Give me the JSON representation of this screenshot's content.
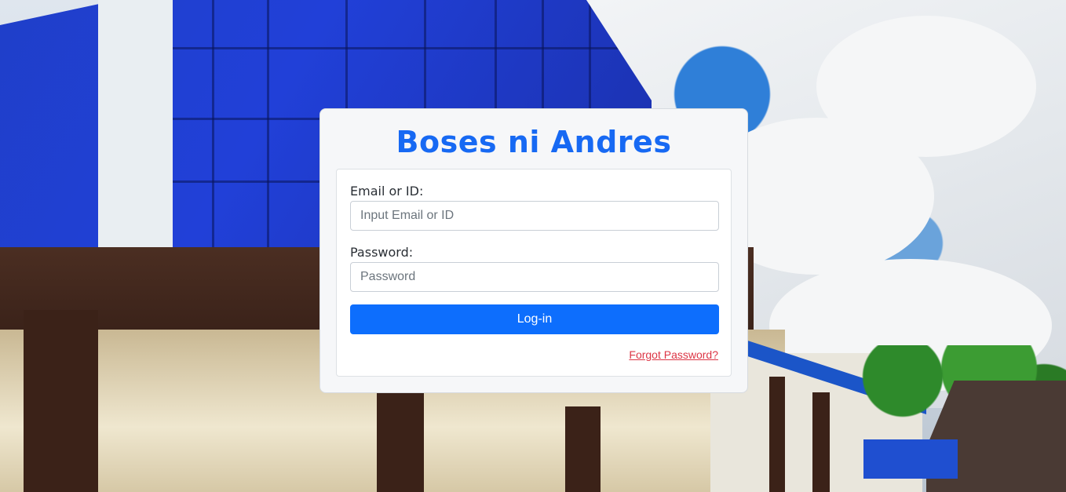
{
  "app": {
    "title": "Boses ni Andres"
  },
  "login_form": {
    "email_label": "Email or ID:",
    "email_placeholder": "Input Email or ID",
    "email_value": "",
    "password_label": "Password:",
    "password_placeholder": "Password",
    "password_value": "",
    "login_button_label": "Log-in",
    "forgot_password_link": "Forgot Password?"
  },
  "colors": {
    "title": "#1769f3",
    "primary_button": "#0d6efd",
    "forgot_link": "#dc3545"
  }
}
